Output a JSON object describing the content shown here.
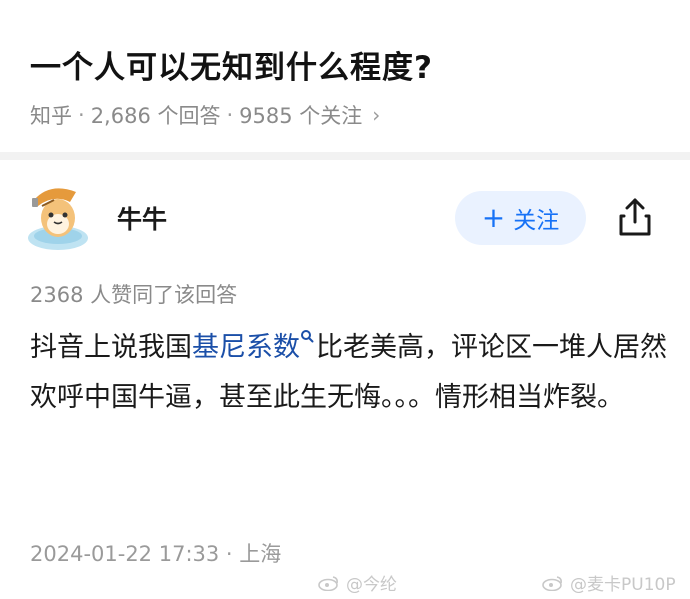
{
  "question": {
    "title": "一个人可以无知到什么程度?",
    "source": "知乎",
    "sep1": "·",
    "answers": "2,686 个回答",
    "sep2": "·",
    "followers": "9585 个关注",
    "chevron": "›"
  },
  "author": {
    "name": "牛牛",
    "follow_plus": "+",
    "follow_label": "关注",
    "avatar_icon": "cartoon-cat-avatar-icon",
    "share_icon": "share-icon"
  },
  "answer": {
    "upvotes": "2368 人赞同了该回答",
    "text_before": "抖音上说我国",
    "keyword": "基尼系数",
    "text_after": "比老美高，评论区一堆人居然欢呼中国牛逼，甚至此生无悔。。。情形相当炸裂。",
    "date_location": "2024-01-22 17:33 · 上海"
  },
  "watermarks": {
    "left": "@今纶",
    "right": "@麦卡PU10P"
  },
  "colors": {
    "accent": "#1772f6",
    "link": "#1b4fa8",
    "follow_bg": "#eaf2ff",
    "meta": "#8a8a8a"
  }
}
